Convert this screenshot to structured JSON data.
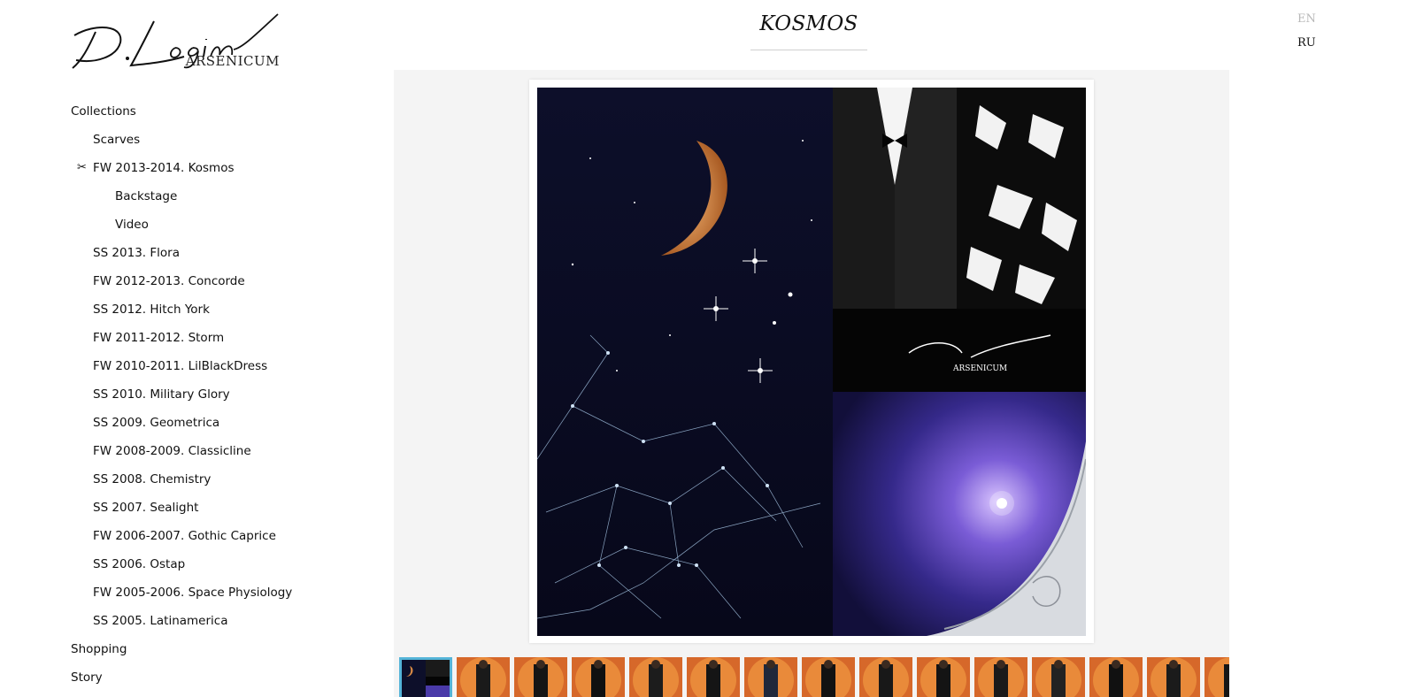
{
  "brand": {
    "logo_signature": "D.Loginov",
    "logo_sub": "ARSENICUM"
  },
  "title": "KOSMOS",
  "languages": {
    "en": "EN",
    "ru": "RU",
    "active": "EN"
  },
  "nav": {
    "collections": "Collections",
    "scarves": "Scarves",
    "current_marker": "✂",
    "current": "FW 2013-2014. Kosmos",
    "backstage": "Backstage",
    "video": "Video",
    "items": [
      "SS 2013. Flora",
      "FW 2012-2013. Concorde",
      "SS 2012. Hitch York",
      "FW 2011-2012. Storm",
      "FW 2010-2011. LilBlackDress",
      "SS 2010. Military Glory",
      "SS 2009. Geometrica",
      "FW 2008-2009. Classicline",
      "SS 2008. Chemistry",
      "SS 2007. Sealight",
      "FW 2006-2007. Gothic Caprice",
      "SS 2006. Ostap",
      "FW 2005-2006. Space Physiology",
      "SS 2005. Latinamerica"
    ],
    "shopping": "Shopping",
    "story": "Story"
  },
  "colors": {
    "thumb_active_border": "#54b4d8",
    "gallery_bg": "#f4f4f4",
    "thumb_orange": "#d86a2a"
  },
  "thumbnails": [
    {
      "kind": "cover",
      "active": true
    },
    {
      "kind": "look",
      "active": false
    },
    {
      "kind": "look",
      "active": false
    },
    {
      "kind": "look",
      "active": false
    },
    {
      "kind": "look",
      "active": false
    },
    {
      "kind": "look",
      "active": false
    },
    {
      "kind": "look",
      "active": false
    },
    {
      "kind": "look",
      "active": false
    },
    {
      "kind": "look",
      "active": false
    },
    {
      "kind": "look",
      "active": false
    },
    {
      "kind": "look",
      "active": false
    },
    {
      "kind": "look",
      "active": false
    },
    {
      "kind": "look",
      "active": false
    },
    {
      "kind": "look",
      "active": false
    },
    {
      "kind": "look",
      "active": false
    }
  ]
}
